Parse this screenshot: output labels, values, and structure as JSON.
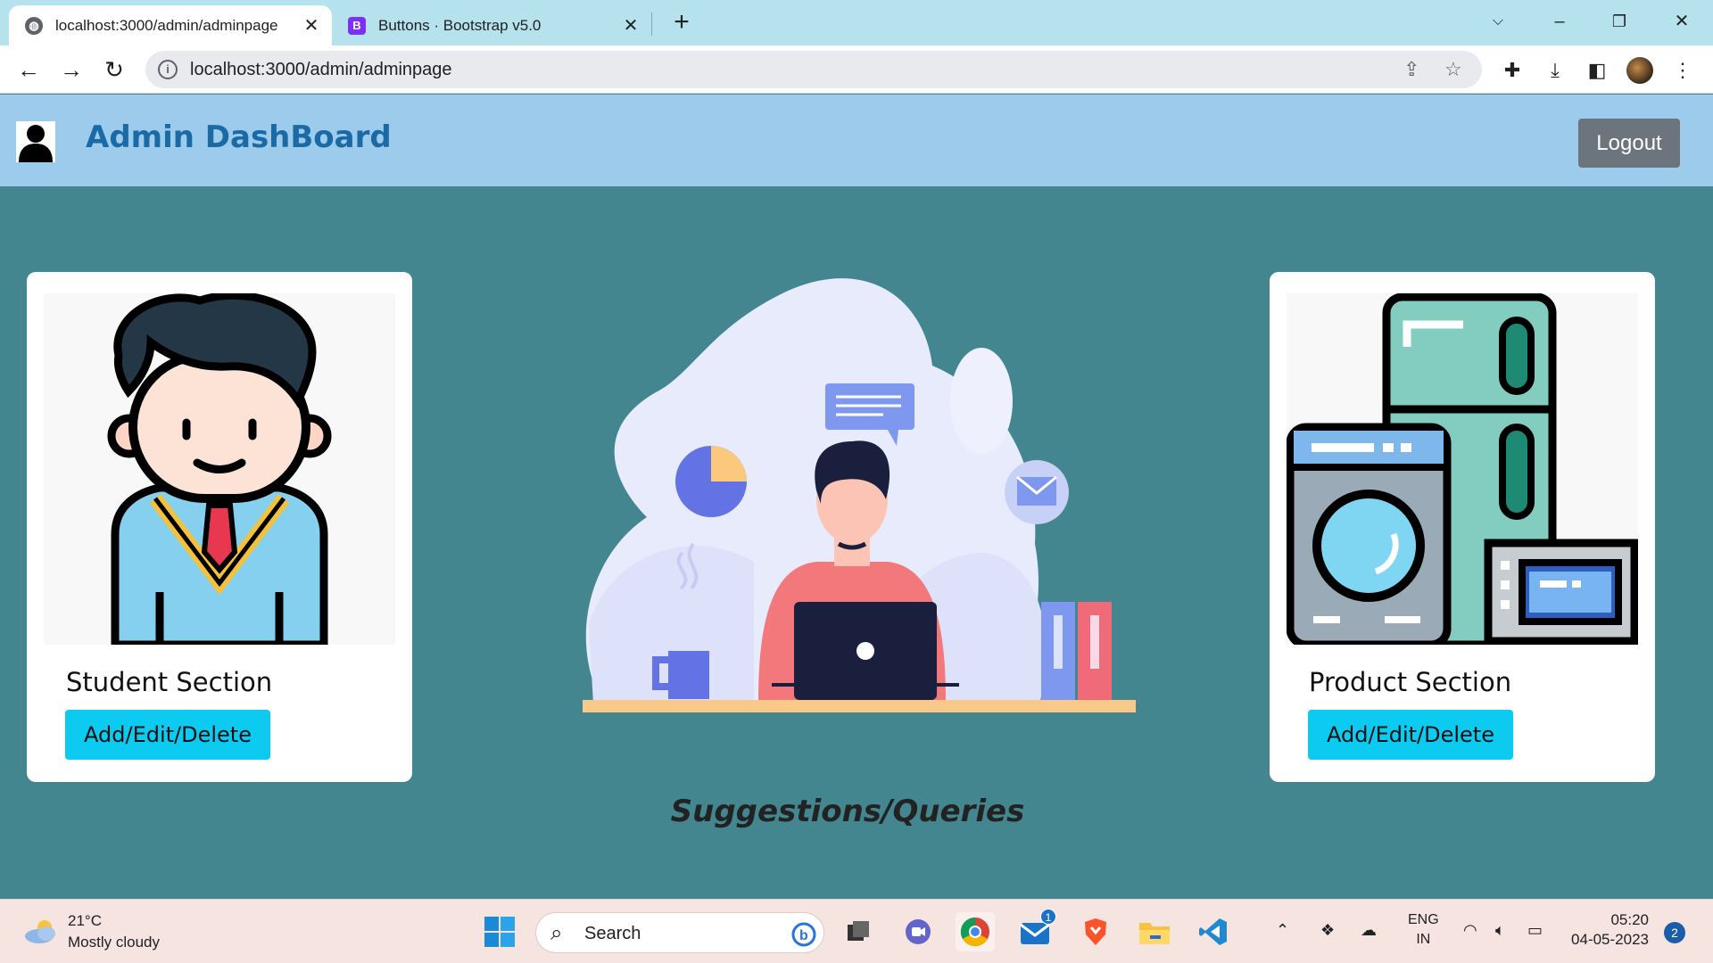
{
  "browser": {
    "tabs": [
      {
        "title": "localhost:3000/admin/adminpage",
        "active": true
      },
      {
        "title": "Buttons · Bootstrap v5.0",
        "active": false
      }
    ],
    "url": "localhost:3000/admin/adminpage"
  },
  "header": {
    "brand": "Admin DashBoard",
    "logout_label": "Logout"
  },
  "cards": [
    {
      "title": "Student Section",
      "button_label": "Add/Edit/Delete"
    },
    {
      "title": "Product Section",
      "button_label": "Add/Edit/Delete"
    }
  ],
  "main": {
    "suggestions_heading": "Suggestions/Queries"
  },
  "colors": {
    "appbar": "#9ccbeb",
    "page_bg": "#43868f",
    "brand_text": "#1a6aa5",
    "card_button": "#0dcaf0",
    "logout_button": "#6c757d"
  },
  "taskbar": {
    "weather": {
      "temp": "21°C",
      "desc": "Mostly cloudy"
    },
    "search_placeholder": "Search",
    "mail_badge": "1",
    "language": {
      "top": "ENG",
      "bottom": "IN"
    },
    "time": "05:20",
    "date": "04-05-2023",
    "notifications": "2"
  }
}
